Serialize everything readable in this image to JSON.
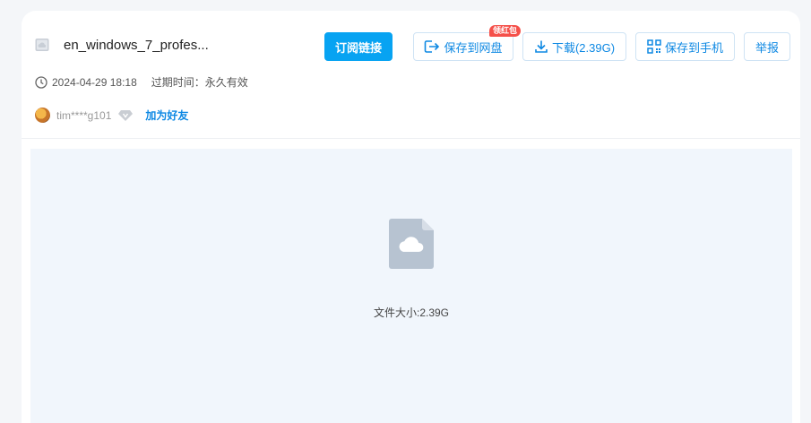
{
  "file": {
    "name": "en_windows_7_profes...",
    "icon": "cloud-file-icon"
  },
  "actions": {
    "subscribe_label": "订阅链接",
    "save_label": "保存到网盘",
    "save_badge": "领红包",
    "download_label": "下载(2.39G)",
    "save_phone_label": "保存到手机",
    "report_label": "举报"
  },
  "meta": {
    "date": "2024-04-29 18:18",
    "expire_label": "过期时间：",
    "expire_value": "永久有效"
  },
  "user": {
    "name": "tim****g101",
    "add_friend_label": "加为好友"
  },
  "preview": {
    "size_text": "文件大小:2.39G"
  },
  "colors": {
    "accent": "#0d88e3",
    "primary_button": "#07a3f2",
    "badge": "#f5504a",
    "preview_bg": "#f1f6fc"
  }
}
